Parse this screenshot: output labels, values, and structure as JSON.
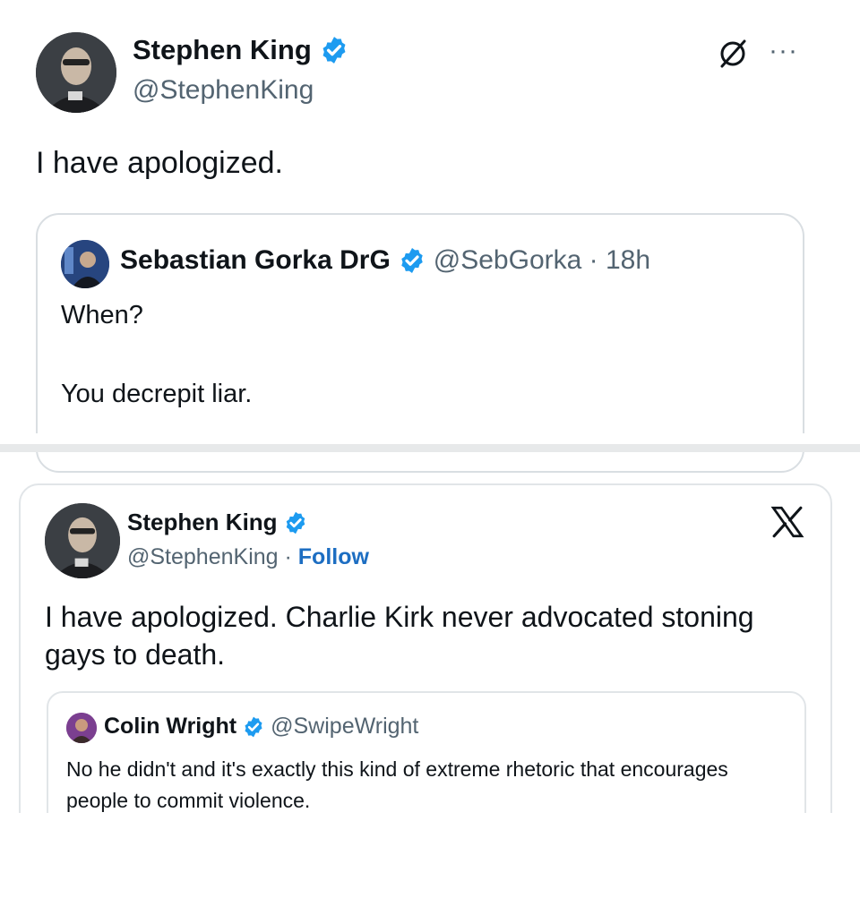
{
  "colors": {
    "verified": "#1d9bf0",
    "follow_link": "#1d6ec2",
    "secondary_text": "#536471",
    "divider": "#e7e9ea"
  },
  "top_tweet": {
    "author_name": "Stephen King",
    "handle": "@StephenKing",
    "avatar_icon": "avatar-photo",
    "actions": [
      "grok-icon",
      "more-icon"
    ],
    "more_label": "···",
    "text": "I have apologized.",
    "quote": {
      "author_name": "Sebastian Gorka DrG",
      "handle_time": "@SebGorka · 18h",
      "line1": "When?",
      "line2": "You decrepit liar."
    }
  },
  "embedded_tweet": {
    "author_name": "Stephen King",
    "handle": "@StephenKing",
    "separator": " · ",
    "follow_label": "Follow",
    "logo_icon": "x-logo-icon",
    "text": "I have apologized. Charlie Kirk never advocated stoning gays to death.",
    "quote": {
      "author_name": "Colin Wright",
      "handle": "@SwipeWright",
      "text": "No he didn't and it's exactly this kind of extreme rhetoric that encourages people to commit violence."
    }
  }
}
